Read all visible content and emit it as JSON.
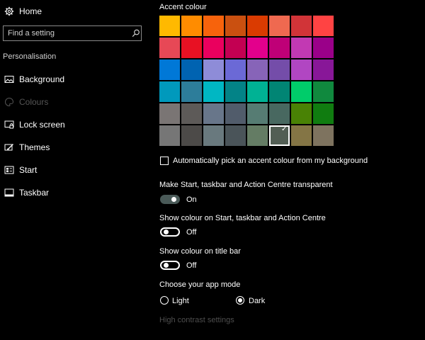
{
  "sidebar": {
    "home_label": "Home",
    "search_placeholder": "Find a setting",
    "section_title": "Personalisation",
    "items": [
      {
        "label": "Background",
        "icon": "picture-icon"
      },
      {
        "label": "Colours",
        "icon": "palette-icon",
        "selected": true
      },
      {
        "label": "Lock screen",
        "icon": "lock-screen-icon"
      },
      {
        "label": "Themes",
        "icon": "brush-icon"
      },
      {
        "label": "Start",
        "icon": "start-icon"
      },
      {
        "label": "Taskbar",
        "icon": "taskbar-icon"
      }
    ]
  },
  "main": {
    "accent_title": "Accent colour",
    "swatches": [
      [
        "#ffb900",
        "#ff8c00",
        "#f7630c",
        "#ca5010",
        "#da3b01",
        "#ef6950",
        "#d13438",
        "#ff4343"
      ],
      [
        "#e74856",
        "#e81123",
        "#ea005e",
        "#c30052",
        "#e3008c",
        "#bf0077",
        "#c239b3",
        "#9a0089"
      ],
      [
        "#0078d7",
        "#0063b1",
        "#8e8cd8",
        "#6b69d6",
        "#8764b8",
        "#744da9",
        "#b146c2",
        "#881798"
      ],
      [
        "#0099bc",
        "#2d7d9a",
        "#00b7c3",
        "#038387",
        "#00b294",
        "#018574",
        "#00cc6a",
        "#10893e"
      ],
      [
        "#7a7574",
        "#5d5a58",
        "#68768a",
        "#515c6b",
        "#567c73",
        "#486860",
        "#498205",
        "#107c10"
      ],
      [
        "#767676",
        "#4c4a48",
        "#69797e",
        "#4a5459",
        "#647c64",
        "#525e54",
        "#847545",
        "#7e735f"
      ]
    ],
    "selected_swatch": {
      "row": 5,
      "col": 5
    },
    "auto_pick_label": "Automatically pick an accent colour from my background",
    "auto_pick_checked": false,
    "transparent": {
      "label": "Make Start, taskbar and Action Centre transparent",
      "state": "On"
    },
    "show_start": {
      "label": "Show colour on Start, taskbar and Action Centre",
      "state": "Off"
    },
    "show_title": {
      "label": "Show colour on title bar",
      "state": "Off"
    },
    "app_mode": {
      "label": "Choose your app mode",
      "options": [
        "Light",
        "Dark"
      ],
      "selected": "Dark"
    },
    "high_contrast_link": "High contrast settings"
  }
}
